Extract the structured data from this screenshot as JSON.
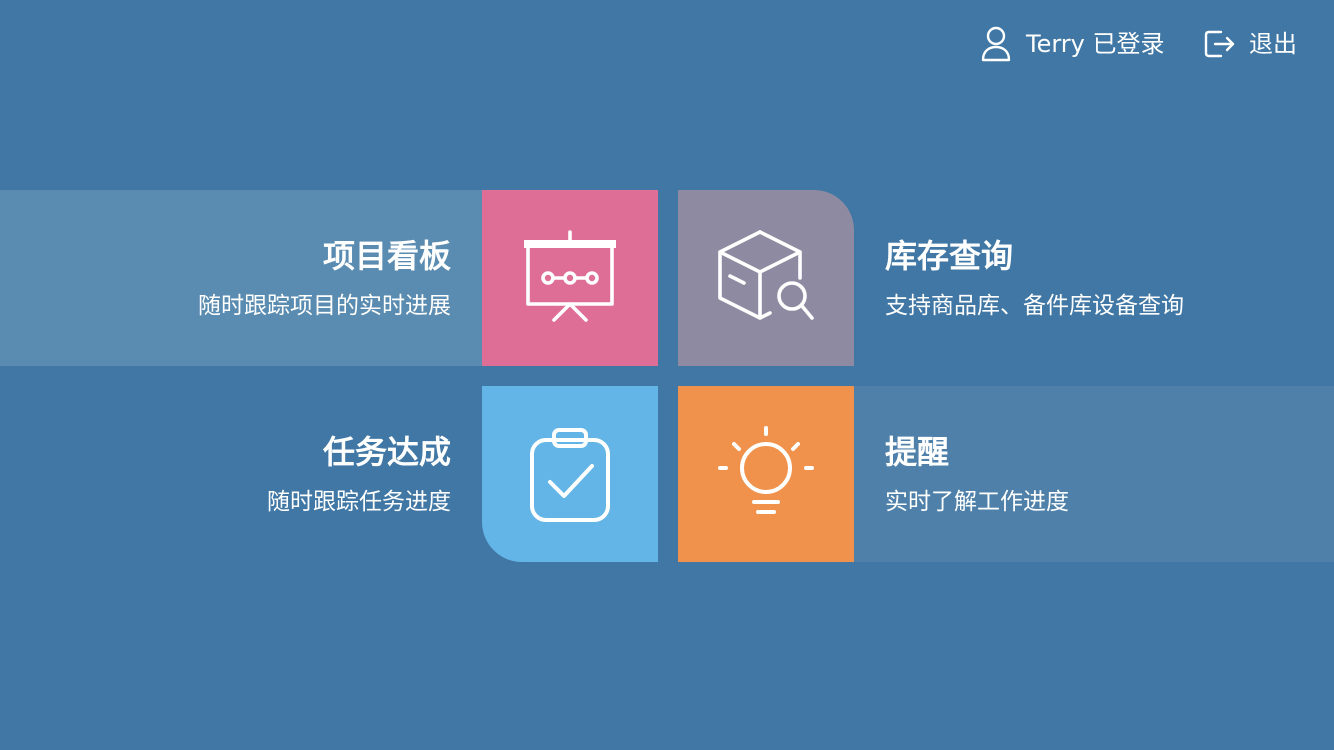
{
  "header": {
    "user_label": "Terry 已登录",
    "logout_label": "退出",
    "user_icon": "user-icon",
    "logout_icon": "logout-icon"
  },
  "colors": {
    "background": "#4077a5",
    "kanban": "#de6e95",
    "stock": "#8e8aa1",
    "task": "#63b5e7",
    "remind": "#f0924c"
  },
  "menu": {
    "kanban": {
      "title": "项目看板",
      "subtitle": "随时跟踪项目的实时进展",
      "icon": "presentation-board-icon"
    },
    "stock": {
      "title": "库存查询",
      "subtitle": "支持商品库、备件库设备查询",
      "icon": "box-search-icon"
    },
    "task": {
      "title": "任务达成",
      "subtitle": "随时跟踪任务进度",
      "icon": "clipboard-check-icon"
    },
    "remind": {
      "title": "提醒",
      "subtitle": "实时了解工作进度",
      "icon": "lightbulb-icon"
    }
  }
}
